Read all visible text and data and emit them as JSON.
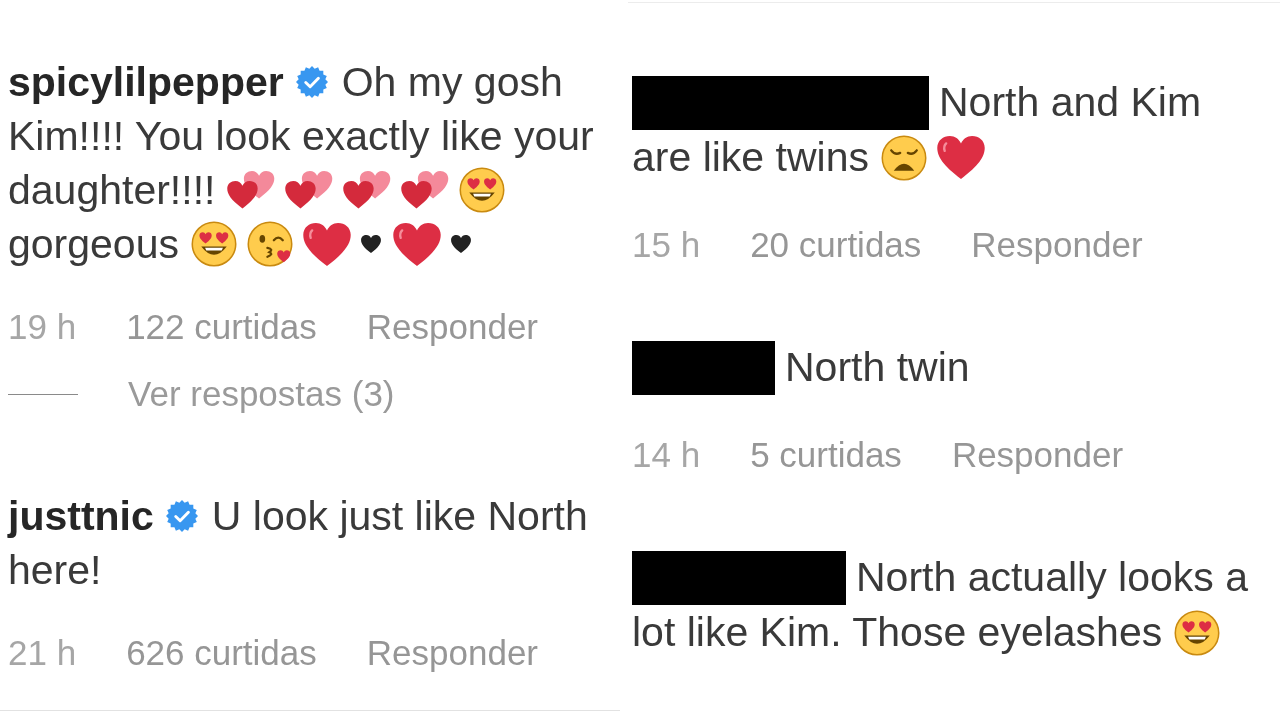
{
  "panels": [
    {
      "comments": [
        {
          "author": {
            "kind": "user",
            "username": "spicylilpepper",
            "verified": true
          },
          "body": [
            {
              "kind": "text",
              "text": "Oh my gosh"
            },
            {
              "kind": "text",
              "text": "Kim!!!! You look exactly like your"
            },
            {
              "kind": "text",
              "text": "daughter!!!!"
            },
            {
              "kind": "two_hearts"
            },
            {
              "kind": "two_hearts"
            },
            {
              "kind": "two_hearts"
            },
            {
              "kind": "two_hearts"
            },
            {
              "kind": "heart_eyes"
            },
            {
              "kind": "text",
              "text": "gorgeous"
            },
            {
              "kind": "heart_eyes"
            },
            {
              "kind": "kiss_wink"
            },
            {
              "kind": "red_heart"
            },
            {
              "kind": "black_heart"
            },
            {
              "kind": "red_heart"
            },
            {
              "kind": "black_heart"
            }
          ],
          "time": "19 h",
          "likes": "122 curtidas",
          "reply": "Responder",
          "view_replies": "Ver respostas (3)"
        },
        {
          "author": {
            "kind": "user",
            "username": "justtnic",
            "verified": true
          },
          "body": [
            {
              "kind": "text",
              "text": "U look just like North"
            },
            {
              "kind": "text",
              "text": "here!"
            }
          ],
          "time": "21 h",
          "likes": "626 curtidas",
          "reply": "Responder"
        }
      ]
    },
    {
      "comments": [
        {
          "author": {
            "kind": "redacted"
          },
          "body": [
            {
              "kind": "text",
              "text": "North and Kim"
            },
            {
              "kind": "text",
              "text": "are like twins"
            },
            {
              "kind": "weary_face"
            },
            {
              "kind": "red_heart"
            }
          ],
          "time": "15 h",
          "likes": "20 curtidas",
          "reply": "Responder"
        },
        {
          "author": {
            "kind": "redacted"
          },
          "body": [
            {
              "kind": "text",
              "text": "North twin"
            }
          ],
          "time": "14 h",
          "likes": "5 curtidas",
          "reply": "Responder"
        },
        {
          "author": {
            "kind": "redacted"
          },
          "body": [
            {
              "kind": "text",
              "text": "North actually looks a"
            },
            {
              "kind": "text",
              "text": "lot like Kim. Those eyelashes"
            },
            {
              "kind": "heart_eyes"
            }
          ]
        }
      ]
    }
  ]
}
